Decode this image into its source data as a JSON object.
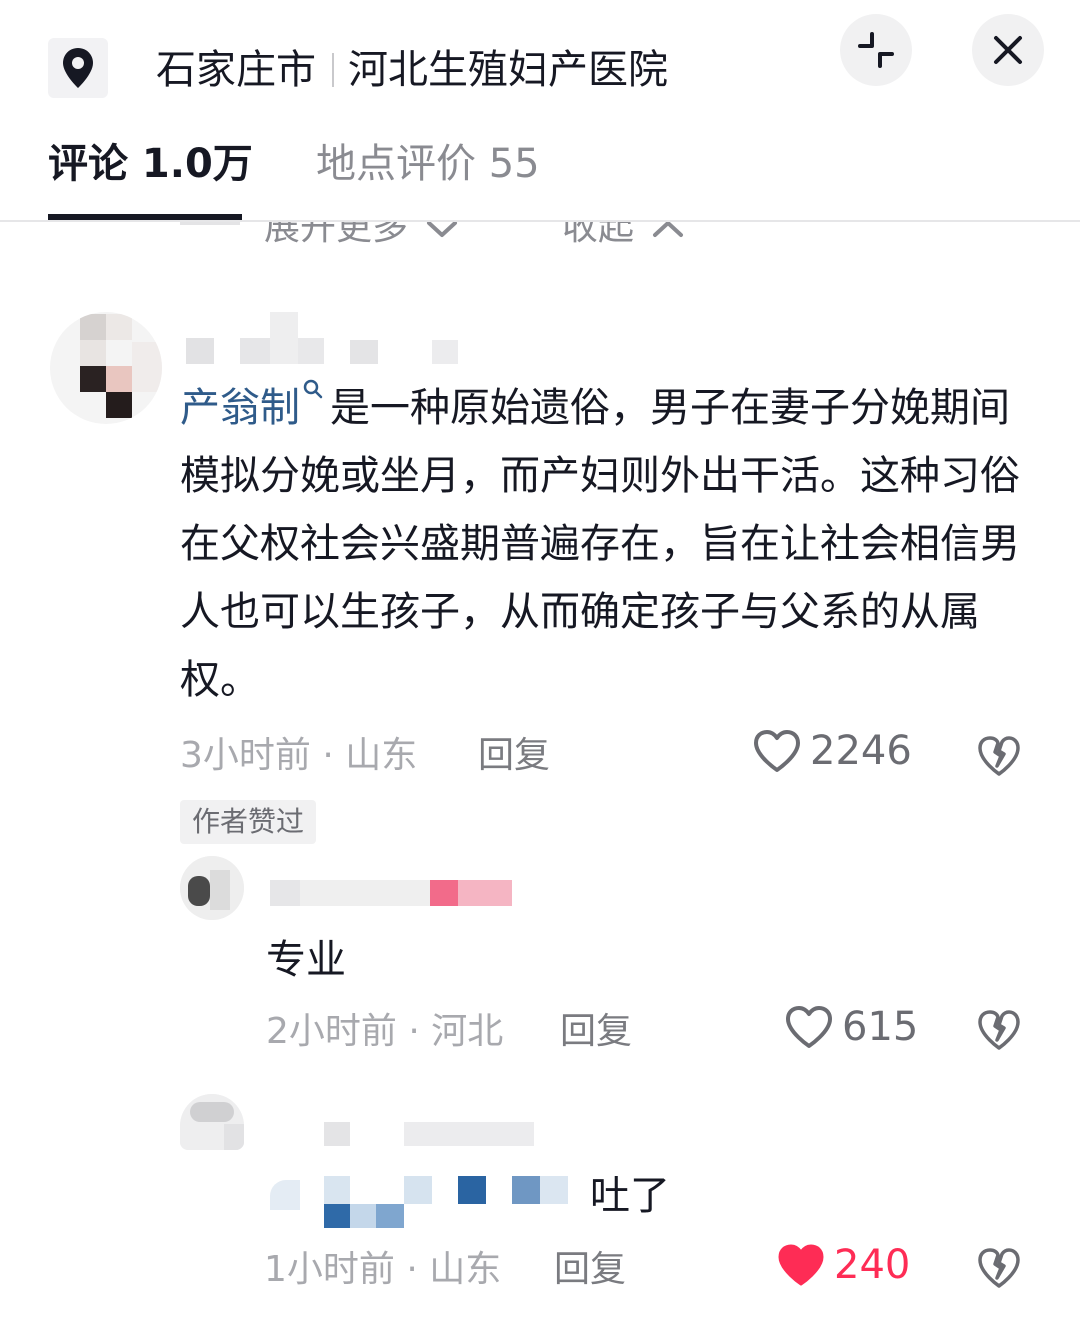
{
  "header": {
    "city": "石家庄市",
    "place": "河北生殖妇产医院",
    "pin_icon": "location-pin-icon",
    "collapse_icon": "collapse-icon",
    "close_icon": "close-icon"
  },
  "tabs": [
    {
      "label": "评论 1.0万",
      "active": true
    },
    {
      "label": "地点评价 55",
      "active": false
    }
  ],
  "peek": {
    "expand_more": "展开更多",
    "collapse": "收起"
  },
  "comments": [
    {
      "link_text": "产翁制",
      "text": "是一种原始遗俗，男子在妻子分娩期间模拟分娩或坐月，而产妇则外出干活。这种习俗在父权社会兴盛期普遍存在，旨在让社会相信男人也可以生孩子，从而确定孩子与父系的从属权。",
      "meta": "3小时前 · 山东",
      "reply_label": "回复",
      "likes": "2246",
      "liked": false,
      "badge": "作者赞过"
    },
    {
      "text": "专业",
      "meta": "2小时前 · 河北",
      "reply_label": "回复",
      "likes": "615",
      "liked": false
    },
    {
      "text": "吐了",
      "meta": "1小时前 · 山东",
      "reply_label": "回复",
      "likes": "240",
      "liked": true
    }
  ],
  "colors": {
    "text": "#161823",
    "muted": "#a8a9ae",
    "link": "#2f5b8a",
    "like_active": "#fe2c55"
  }
}
